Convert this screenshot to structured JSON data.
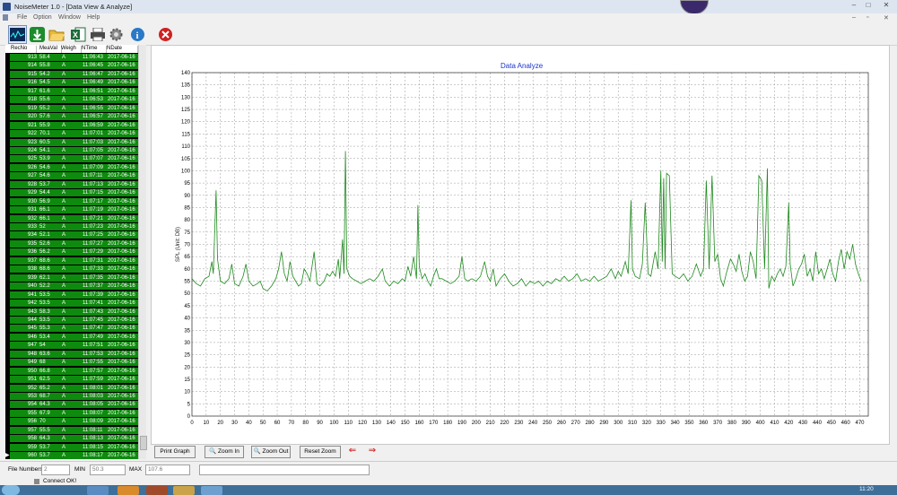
{
  "window": {
    "title": "NoiseMeter 1.0  - [Data View & Analyze]",
    "controls": [
      "–",
      "□",
      "✕"
    ]
  },
  "menu": [
    "File",
    "Option",
    "Window",
    "Help"
  ],
  "toolbar": [
    {
      "name": "realtime-icon"
    },
    {
      "name": "download-icon"
    },
    {
      "name": "open-folder-icon"
    },
    {
      "name": "excel-export-icon"
    },
    {
      "name": "print-icon"
    },
    {
      "name": "settings-icon"
    },
    {
      "name": "info-icon"
    },
    {
      "name": "close-icon"
    }
  ],
  "table": {
    "columns": [
      "RecNo",
      "MeaVal",
      "Weigh",
      "NTime",
      "NDate"
    ],
    "rows": [
      [
        "913",
        "58.4",
        "A",
        "11:06:43",
        "2017-06-16"
      ],
      [
        "914",
        "55.8",
        "A",
        "11:06:45",
        "2017-06-16"
      ],
      [
        "915",
        "54.2",
        "A",
        "11:06:47",
        "2017-06-16"
      ],
      [
        "916",
        "54.5",
        "A",
        "11:06:49",
        "2017-06-16"
      ],
      [
        "917",
        "61.6",
        "A",
        "11:06:51",
        "2017-06-16"
      ],
      [
        "918",
        "55.6",
        "A",
        "11:06:53",
        "2017-06-16"
      ],
      [
        "919",
        "55.2",
        "A",
        "11:06:55",
        "2017-06-16"
      ],
      [
        "920",
        "57.6",
        "A",
        "11:06:57",
        "2017-06-16"
      ],
      [
        "921",
        "55.9",
        "A",
        "11:06:59",
        "2017-06-16"
      ],
      [
        "922",
        "70.1",
        "A",
        "11:07:01",
        "2017-06-16"
      ],
      [
        "923",
        "60.5",
        "A",
        "11:07:03",
        "2017-06-16"
      ],
      [
        "924",
        "54.1",
        "A",
        "11:07:05",
        "2017-06-16"
      ],
      [
        "925",
        "53.9",
        "A",
        "11:07:07",
        "2017-06-16"
      ],
      [
        "926",
        "54.6",
        "A",
        "11:07:09",
        "2017-06-16"
      ],
      [
        "927",
        "54.6",
        "A",
        "11:07:11",
        "2017-06-16"
      ],
      [
        "928",
        "53.7",
        "A",
        "11:07:13",
        "2017-06-16"
      ],
      [
        "929",
        "54.4",
        "A",
        "11:07:15",
        "2017-06-16"
      ],
      [
        "930",
        "56.9",
        "A",
        "11:07:17",
        "2017-06-16"
      ],
      [
        "931",
        "66.1",
        "A",
        "11:07:19",
        "2017-06-16"
      ],
      [
        "932",
        "66.1",
        "A",
        "11:07:21",
        "2017-06-16"
      ],
      [
        "933",
        "52",
        "A",
        "11:07:23",
        "2017-06-16"
      ],
      [
        "934",
        "52.1",
        "A",
        "11:07:25",
        "2017-06-16"
      ],
      [
        "935",
        "52.6",
        "A",
        "11:07:27",
        "2017-06-16"
      ],
      [
        "936",
        "56.2",
        "A",
        "11:07:29",
        "2017-06-16"
      ],
      [
        "937",
        "68.6",
        "A",
        "11:07:31",
        "2017-06-16"
      ],
      [
        "938",
        "68.6",
        "A",
        "11:07:33",
        "2017-06-16"
      ],
      [
        "939",
        "62.1",
        "A",
        "11:07:35",
        "2017-06-16"
      ],
      [
        "940",
        "52.2",
        "A",
        "11:07:37",
        "2017-06-16"
      ],
      [
        "941",
        "53.5",
        "A",
        "11:07:39",
        "2017-06-16"
      ],
      [
        "942",
        "53.5",
        "A",
        "11:07:41",
        "2017-06-16"
      ],
      [
        "943",
        "58.3",
        "A",
        "11:07:43",
        "2017-06-16"
      ],
      [
        "944",
        "53.5",
        "A",
        "11:07:45",
        "2017-06-16"
      ],
      [
        "945",
        "55.3",
        "A",
        "11:07:47",
        "2017-06-16"
      ],
      [
        "946",
        "53.4",
        "A",
        "11:07:49",
        "2017-06-16"
      ],
      [
        "947",
        "54",
        "A",
        "11:07:51",
        "2017-06-16"
      ],
      [
        "948",
        "63.6",
        "A",
        "11:07:53",
        "2017-06-16"
      ],
      [
        "949",
        "68",
        "A",
        "11:07:55",
        "2017-06-16"
      ],
      [
        "950",
        "66.8",
        "A",
        "11:07:57",
        "2017-06-16"
      ],
      [
        "951",
        "62.5",
        "A",
        "11:07:59",
        "2017-06-16"
      ],
      [
        "952",
        "65.2",
        "A",
        "11:08:01",
        "2017-06-16"
      ],
      [
        "953",
        "68.7",
        "A",
        "11:08:03",
        "2017-06-16"
      ],
      [
        "954",
        "64.3",
        "A",
        "11:08:05",
        "2017-06-16"
      ],
      [
        "955",
        "67.9",
        "A",
        "11:08:07",
        "2017-06-16"
      ],
      [
        "956",
        "70",
        "A",
        "11:08:09",
        "2017-06-16"
      ],
      [
        "957",
        "55.5",
        "A",
        "11:08:11",
        "2017-06-16"
      ],
      [
        "958",
        "64.3",
        "A",
        "11:08:13",
        "2017-06-16"
      ],
      [
        "959",
        "53.7",
        "A",
        "11:08:15",
        "2017-06-16"
      ],
      [
        "960",
        "53.7",
        "A",
        "11:08:17",
        "2017-06-16"
      ]
    ]
  },
  "chart_data": {
    "type": "line",
    "title": "Data Analyze",
    "xlabel": "",
    "ylabel": "SPL  (Unit: DB)",
    "xlim": [
      0,
      476
    ],
    "ylim": [
      0,
      140
    ],
    "xticks": [
      0,
      10,
      20,
      30,
      40,
      50,
      60,
      70,
      80,
      90,
      100,
      110,
      120,
      130,
      140,
      150,
      160,
      170,
      180,
      190,
      200,
      210,
      220,
      230,
      240,
      250,
      260,
      270,
      280,
      290,
      300,
      310,
      320,
      330,
      340,
      350,
      360,
      370,
      380,
      390,
      400,
      410,
      420,
      430,
      440,
      450,
      460,
      470
    ],
    "yticks": [
      0,
      5,
      10,
      15,
      20,
      25,
      30,
      35,
      40,
      45,
      50,
      55,
      60,
      65,
      70,
      75,
      80,
      85,
      90,
      95,
      100,
      105,
      110,
      115,
      120,
      125,
      130,
      135,
      140
    ],
    "grid": true,
    "color": "#1e8a1e",
    "series": [
      {
        "points": [
          [
            0,
            56
          ],
          [
            3,
            54
          ],
          [
            6,
            53
          ],
          [
            9,
            56
          ],
          [
            12,
            57
          ],
          [
            14,
            63
          ],
          [
            15,
            58
          ],
          [
            17,
            92
          ],
          [
            18,
            64
          ],
          [
            20,
            55
          ],
          [
            23,
            54
          ],
          [
            26,
            56
          ],
          [
            28,
            62
          ],
          [
            30,
            54
          ],
          [
            33,
            53
          ],
          [
            36,
            57
          ],
          [
            38,
            62
          ],
          [
            40,
            55
          ],
          [
            43,
            53
          ],
          [
            46,
            54
          ],
          [
            48,
            55
          ],
          [
            50,
            52
          ],
          [
            53,
            51
          ],
          [
            56,
            53
          ],
          [
            59,
            56
          ],
          [
            61,
            60
          ],
          [
            63,
            67
          ],
          [
            65,
            58
          ],
          [
            67,
            55
          ],
          [
            69,
            63
          ],
          [
            71,
            57
          ],
          [
            73,
            55
          ],
          [
            75,
            53
          ],
          [
            77,
            54
          ],
          [
            79,
            60
          ],
          [
            81,
            58
          ],
          [
            83,
            55
          ],
          [
            86,
            67
          ],
          [
            88,
            54
          ],
          [
            90,
            53
          ],
          [
            93,
            55
          ],
          [
            95,
            58
          ],
          [
            97,
            57
          ],
          [
            99,
            59
          ],
          [
            101,
            57
          ],
          [
            103,
            64
          ],
          [
            104,
            56
          ],
          [
            106,
            72
          ],
          [
            107,
            58
          ],
          [
            108,
            108
          ],
          [
            109,
            60
          ],
          [
            111,
            57
          ],
          [
            113,
            56
          ],
          [
            116,
            55
          ],
          [
            119,
            54
          ],
          [
            122,
            55
          ],
          [
            125,
            56
          ],
          [
            128,
            55
          ],
          [
            131,
            57
          ],
          [
            134,
            60
          ],
          [
            136,
            55
          ],
          [
            139,
            53
          ],
          [
            142,
            55
          ],
          [
            145,
            54
          ],
          [
            148,
            56
          ],
          [
            150,
            55
          ],
          [
            152,
            61
          ],
          [
            154,
            57
          ],
          [
            156,
            65
          ],
          [
            158,
            56
          ],
          [
            159,
            86
          ],
          [
            160,
            61
          ],
          [
            162,
            56
          ],
          [
            164,
            58
          ],
          [
            166,
            55
          ],
          [
            168,
            53
          ],
          [
            170,
            57
          ],
          [
            172,
            60
          ],
          [
            174,
            56
          ],
          [
            176,
            56
          ],
          [
            179,
            55
          ],
          [
            182,
            54
          ],
          [
            185,
            55
          ],
          [
            188,
            57
          ],
          [
            190,
            65
          ],
          [
            192,
            56
          ],
          [
            194,
            55
          ],
          [
            197,
            56
          ],
          [
            200,
            55
          ],
          [
            203,
            57
          ],
          [
            206,
            63
          ],
          [
            208,
            57
          ],
          [
            210,
            55
          ],
          [
            212,
            60
          ],
          [
            214,
            53
          ],
          [
            217,
            56
          ],
          [
            220,
            58
          ],
          [
            223,
            55
          ],
          [
            226,
            53
          ],
          [
            229,
            54
          ],
          [
            232,
            56
          ],
          [
            235,
            53
          ],
          [
            238,
            55
          ],
          [
            241,
            54
          ],
          [
            244,
            55
          ],
          [
            247,
            53
          ],
          [
            250,
            55
          ],
          [
            253,
            54
          ],
          [
            256,
            56
          ],
          [
            259,
            55
          ],
          [
            262,
            57
          ],
          [
            265,
            55
          ],
          [
            268,
            56
          ],
          [
            271,
            58
          ],
          [
            274,
            55
          ],
          [
            277,
            56
          ],
          [
            280,
            55
          ],
          [
            283,
            57
          ],
          [
            286,
            55
          ],
          [
            289,
            56
          ],
          [
            292,
            57
          ],
          [
            295,
            60
          ],
          [
            298,
            56
          ],
          [
            300,
            59
          ],
          [
            302,
            57
          ],
          [
            305,
            63
          ],
          [
            307,
            58
          ],
          [
            309,
            88
          ],
          [
            310,
            60
          ],
          [
            312,
            57
          ],
          [
            315,
            56
          ],
          [
            317,
            62
          ],
          [
            319,
            87
          ],
          [
            321,
            58
          ],
          [
            323,
            57
          ],
          [
            326,
            67
          ],
          [
            328,
            60
          ],
          [
            330,
            100
          ],
          [
            331,
            63
          ],
          [
            332,
            97
          ],
          [
            333,
            60
          ],
          [
            334,
            99
          ],
          [
            336,
            98
          ],
          [
            338,
            58
          ],
          [
            340,
            57
          ],
          [
            343,
            56
          ],
          [
            346,
            58
          ],
          [
            349,
            55
          ],
          [
            352,
            57
          ],
          [
            355,
            62
          ],
          [
            358,
            57
          ],
          [
            360,
            60
          ],
          [
            362,
            96
          ],
          [
            364,
            60
          ],
          [
            366,
            98
          ],
          [
            368,
            63
          ],
          [
            370,
            66
          ],
          [
            372,
            56
          ],
          [
            374,
            53
          ],
          [
            376,
            58
          ],
          [
            379,
            64
          ],
          [
            381,
            62
          ],
          [
            383,
            59
          ],
          [
            385,
            66
          ],
          [
            387,
            59
          ],
          [
            389,
            55
          ],
          [
            391,
            57
          ],
          [
            393,
            67
          ],
          [
            395,
            63
          ],
          [
            397,
            56
          ],
          [
            399,
            98
          ],
          [
            401,
            96
          ],
          [
            403,
            60
          ],
          [
            405,
            101
          ],
          [
            406,
            52
          ],
          [
            408,
            57
          ],
          [
            410,
            55
          ],
          [
            412,
            58
          ],
          [
            414,
            60
          ],
          [
            416,
            57
          ],
          [
            418,
            61
          ],
          [
            420,
            87
          ],
          [
            421,
            62
          ],
          [
            423,
            53
          ],
          [
            425,
            56
          ],
          [
            427,
            60
          ],
          [
            429,
            62
          ],
          [
            431,
            66
          ],
          [
            433,
            57
          ],
          [
            435,
            60
          ],
          [
            437,
            55
          ],
          [
            439,
            67
          ],
          [
            441,
            58
          ],
          [
            443,
            60
          ],
          [
            445,
            56
          ],
          [
            447,
            60
          ],
          [
            449,
            64
          ],
          [
            451,
            58
          ],
          [
            453,
            55
          ],
          [
            455,
            63
          ],
          [
            457,
            68
          ],
          [
            459,
            60
          ],
          [
            461,
            67
          ],
          [
            463,
            64
          ],
          [
            465,
            70
          ],
          [
            467,
            62
          ],
          [
            469,
            58
          ],
          [
            471,
            55
          ]
        ]
      }
    ]
  },
  "controls": {
    "print_graph": "Print Graph",
    "zoom_in": "Zoom In",
    "zoom_out": "Zoom Out",
    "reset_zoom": "Reset Zoom"
  },
  "status": {
    "file_numbers_label": "File Numbers",
    "file_numbers_value": "2",
    "min_label": "MIN",
    "min_value": "50.3",
    "max_label": "MAX",
    "max_value": "107.6",
    "connect": "Connect OK!",
    "clock": "11:20"
  }
}
